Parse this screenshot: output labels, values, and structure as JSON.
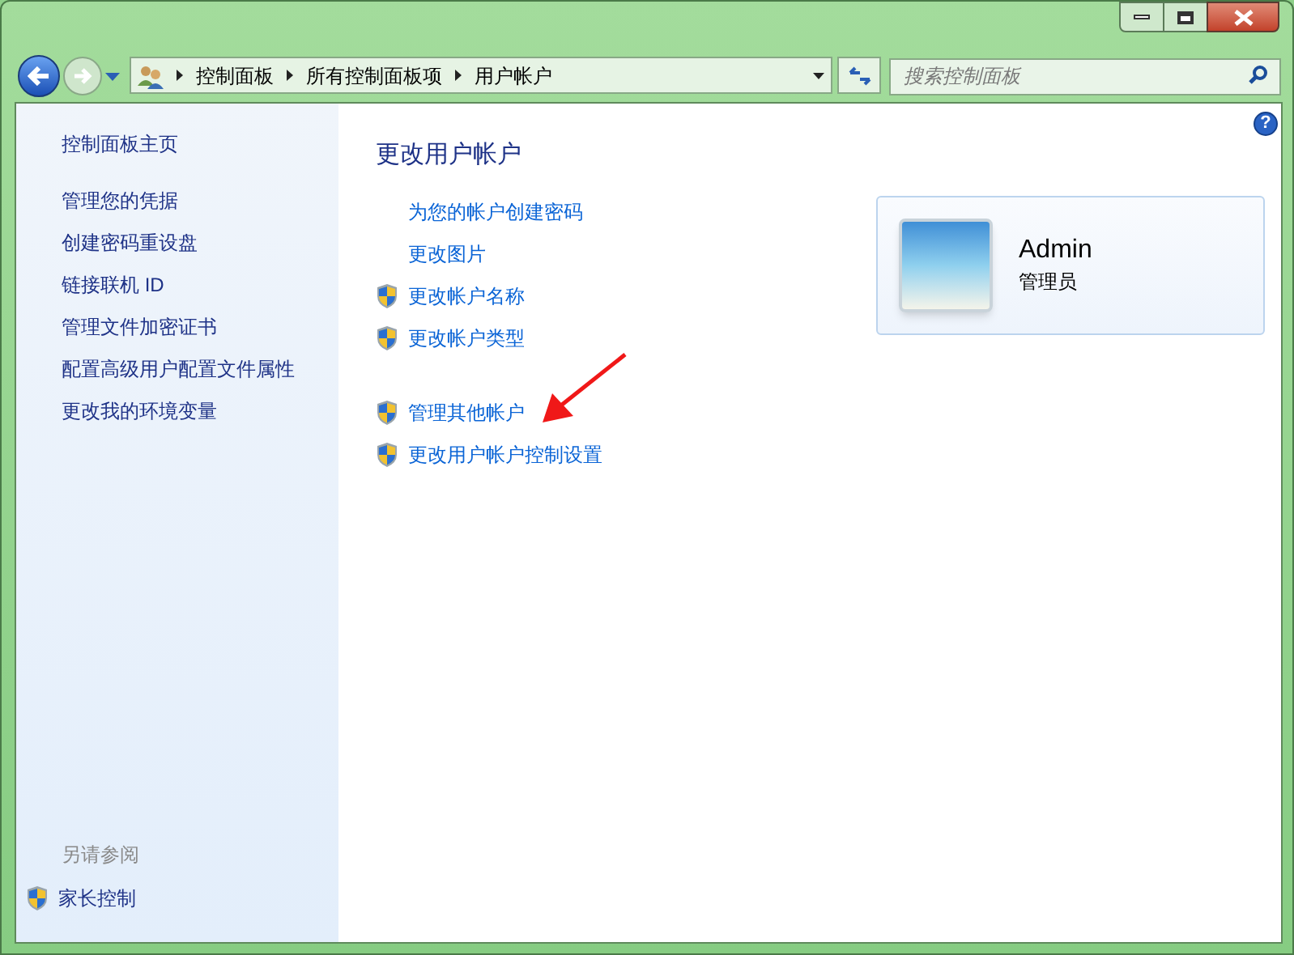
{
  "address_bar": {
    "crumbs": [
      "控制面板",
      "所有控制面板项",
      "用户帐户"
    ]
  },
  "search": {
    "placeholder": "搜索控制面板"
  },
  "sidebar": {
    "home": "控制面板主页",
    "items": [
      "管理您的凭据",
      "创建密码重设盘",
      "链接联机 ID",
      "管理文件加密证书",
      "配置高级用户配置文件属性",
      "更改我的环境变量"
    ],
    "see_also": {
      "heading": "另请参阅",
      "items": [
        {
          "label": "家长控制",
          "shield": true
        }
      ]
    }
  },
  "main": {
    "heading": "更改用户帐户",
    "task_groups": [
      [
        {
          "label": "为您的帐户创建密码",
          "shield": false
        },
        {
          "label": "更改图片",
          "shield": false
        },
        {
          "label": "更改帐户名称",
          "shield": true
        },
        {
          "label": "更改帐户类型",
          "shield": true
        }
      ],
      [
        {
          "label": "管理其他帐户",
          "shield": true
        },
        {
          "label": "更改用户帐户控制设置",
          "shield": true
        }
      ]
    ]
  },
  "help": {
    "symbol": "?"
  },
  "account": {
    "name": "Admin",
    "role": "管理员"
  }
}
